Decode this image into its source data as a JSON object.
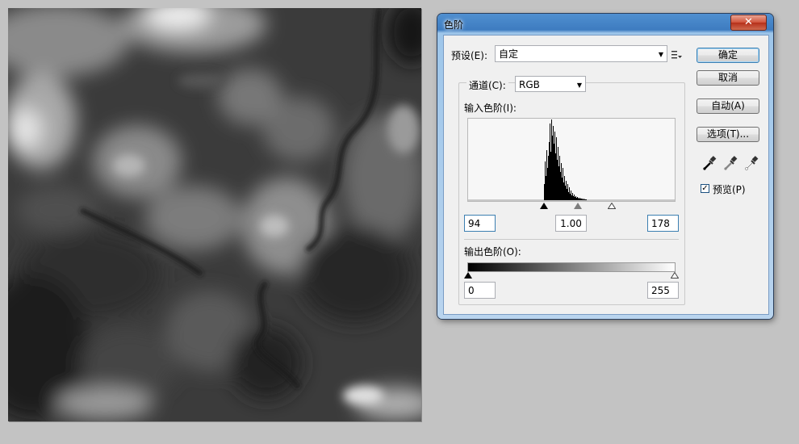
{
  "canvas": {
    "description_icon": "terrain-heightmap-image"
  },
  "dialog": {
    "title": "色阶",
    "close_label": "✕",
    "preset": {
      "label": "预设(E):",
      "value": "自定"
    },
    "channel": {
      "label": "通道(C):",
      "value": "RGB"
    },
    "input_levels": {
      "label": "输入色阶(I):",
      "black": "94",
      "gamma": "1.00",
      "white": "178"
    },
    "output_levels": {
      "label": "输出色阶(O):",
      "black": "0",
      "white": "255"
    },
    "buttons": {
      "ok": "确定",
      "cancel": "取消",
      "auto": "自动(A)",
      "options": "选项(T)..."
    },
    "preview": {
      "label": "预览(P)",
      "checked": true
    },
    "icons": [
      "preset-menu-icon",
      "black-eyedropper-icon",
      "gray-eyedropper-icon",
      "white-eyedropper-icon"
    ]
  },
  "colors": {
    "accent_border": "#3c7fb1",
    "title_gradient_top": "#4f8fd0",
    "close_red": "#c84a30"
  }
}
